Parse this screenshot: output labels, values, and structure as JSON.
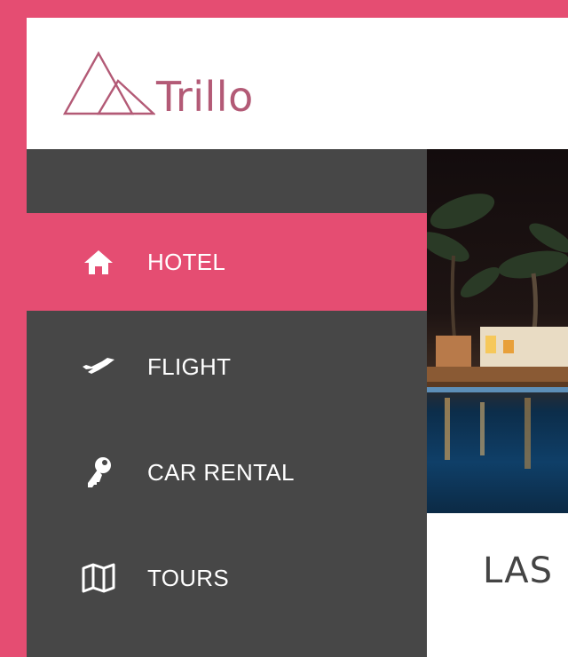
{
  "brand": {
    "name": "Trillo",
    "color": "#b35a76"
  },
  "colors": {
    "accent": "#e54d72",
    "sidebar": "#474747",
    "text": "#ffffff"
  },
  "nav": {
    "items": [
      {
        "label": "HOTEL",
        "icon": "home-icon",
        "active": true
      },
      {
        "label": "FLIGHT",
        "icon": "airplane-icon",
        "active": false
      },
      {
        "label": "CAR RENTAL",
        "icon": "key-icon",
        "active": false
      },
      {
        "label": "TOURS",
        "icon": "map-icon",
        "active": false
      }
    ]
  },
  "main": {
    "hero_alt": "hotel-pool-night-photo",
    "title": "LAS"
  }
}
